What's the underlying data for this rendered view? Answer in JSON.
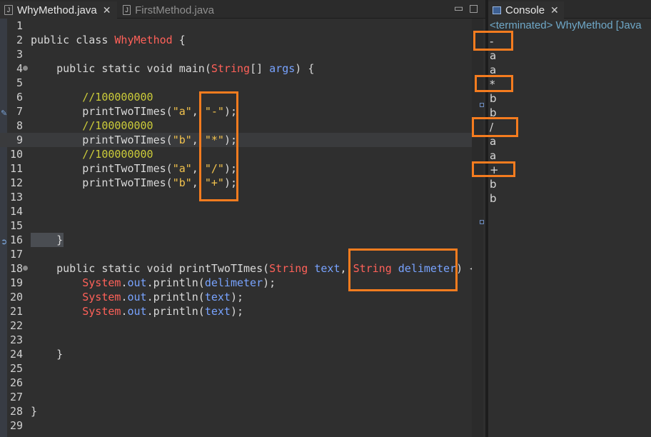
{
  "editor": {
    "tabs": [
      {
        "label": "WhyMethod.java",
        "active": true
      },
      {
        "label": "FirstMethod.java",
        "active": false
      }
    ],
    "lines": [
      {
        "n": "1",
        "tokens": []
      },
      {
        "n": "2",
        "tokens": [
          [
            "kw",
            "public class "
          ],
          [
            "cls",
            "WhyMethod"
          ],
          [
            "pln",
            " {"
          ]
        ]
      },
      {
        "n": "3",
        "tokens": []
      },
      {
        "n": "4",
        "tokens": [
          [
            "kw",
            "    public static void "
          ],
          [
            "pln",
            "main("
          ],
          [
            "typ",
            "String"
          ],
          [
            "pln",
            "[] "
          ],
          [
            "var",
            "args"
          ],
          [
            "pln",
            ") {"
          ]
        ],
        "marker": true
      },
      {
        "n": "5",
        "tokens": []
      },
      {
        "n": "6",
        "tokens": [
          [
            "cmt",
            "        //100000000"
          ]
        ]
      },
      {
        "n": "7",
        "tokens": [
          [
            "pln",
            "        printTwoTImes("
          ],
          [
            "str",
            "\"a\""
          ],
          [
            "pln",
            ", "
          ],
          [
            "str",
            "\"-\""
          ],
          [
            "pln",
            ");"
          ]
        ],
        "gicon": "wrench"
      },
      {
        "n": "8",
        "tokens": [
          [
            "cmt",
            "        //100000000"
          ]
        ]
      },
      {
        "n": "9",
        "tokens": [
          [
            "pln",
            "        printTwoTImes("
          ],
          [
            "str",
            "\"b\""
          ],
          [
            "pln",
            ", "
          ],
          [
            "str",
            "\"*\""
          ],
          [
            "pln",
            ");"
          ]
        ],
        "current": true,
        "caret": true
      },
      {
        "n": "10",
        "tokens": [
          [
            "cmt",
            "        //100000000"
          ]
        ]
      },
      {
        "n": "11",
        "tokens": [
          [
            "pln",
            "        printTwoTImes("
          ],
          [
            "str",
            "\"a\""
          ],
          [
            "pln",
            ", "
          ],
          [
            "str",
            "\"/\""
          ],
          [
            "pln",
            ");"
          ]
        ]
      },
      {
        "n": "12",
        "tokens": [
          [
            "pln",
            "        printTwoTImes("
          ],
          [
            "str",
            "\"b\""
          ],
          [
            "pln",
            ", "
          ],
          [
            "str",
            "\"+\""
          ],
          [
            "pln",
            ");"
          ]
        ]
      },
      {
        "n": "13",
        "tokens": []
      },
      {
        "n": "14",
        "tokens": []
      },
      {
        "n": "15",
        "tokens": []
      },
      {
        "n": "16",
        "tokens": [
          [
            "pln",
            "    }"
          ]
        ],
        "sel": true,
        "gicon": "arrow"
      },
      {
        "n": "17",
        "tokens": []
      },
      {
        "n": "18",
        "tokens": [
          [
            "kw",
            "    public static void "
          ],
          [
            "pln",
            "printTwoTImes("
          ],
          [
            "typ",
            "String"
          ],
          [
            "pln",
            " "
          ],
          [
            "var",
            "text"
          ],
          [
            "pln",
            ", "
          ],
          [
            "typ",
            "String"
          ],
          [
            "pln",
            " "
          ],
          [
            "var",
            "delimeter"
          ],
          [
            "pln",
            ") {"
          ]
        ],
        "marker": true
      },
      {
        "n": "19",
        "tokens": [
          [
            "cls",
            "        System"
          ],
          [
            "pln",
            "."
          ],
          [
            "var",
            "out"
          ],
          [
            "pln",
            ".println("
          ],
          [
            "var",
            "delimeter"
          ],
          [
            "pln",
            ");"
          ]
        ]
      },
      {
        "n": "20",
        "tokens": [
          [
            "cls",
            "        System"
          ],
          [
            "pln",
            "."
          ],
          [
            "var",
            "out"
          ],
          [
            "pln",
            ".println("
          ],
          [
            "var",
            "text"
          ],
          [
            "pln",
            ");"
          ]
        ]
      },
      {
        "n": "21",
        "tokens": [
          [
            "cls",
            "        System"
          ],
          [
            "pln",
            "."
          ],
          [
            "var",
            "out"
          ],
          [
            "pln",
            ".println("
          ],
          [
            "var",
            "text"
          ],
          [
            "pln",
            ");"
          ]
        ]
      },
      {
        "n": "22",
        "tokens": []
      },
      {
        "n": "23",
        "tokens": []
      },
      {
        "n": "24",
        "tokens": [
          [
            "pln",
            "    }"
          ]
        ]
      },
      {
        "n": "25",
        "tokens": []
      },
      {
        "n": "26",
        "tokens": []
      },
      {
        "n": "27",
        "tokens": []
      },
      {
        "n": "28",
        "tokens": [
          [
            "pln",
            "}"
          ]
        ]
      },
      {
        "n": "29",
        "tokens": []
      }
    ]
  },
  "console": {
    "tab_label": "Console",
    "status": "<terminated> WhyMethod [Java",
    "output": [
      "-",
      "a",
      "a",
      "*",
      "b",
      "b",
      "/",
      "a",
      "a",
      "+",
      "b",
      "b"
    ]
  },
  "colors": {
    "highlight": "#f57c1f",
    "keyword": "#d9d9d9",
    "class": "#ff6159",
    "string": "#f3c34d",
    "comment": "#cccc3a",
    "variable": "#78a3ff"
  },
  "icons": {
    "editor_tab": "java-file-icon",
    "console_tab": "console-icon",
    "minimize": "minimize-icon",
    "maximize": "maximize-icon",
    "close": "close-icon"
  }
}
